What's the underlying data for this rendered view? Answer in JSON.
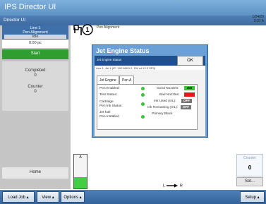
{
  "app": {
    "title": "IPS Director UI",
    "subtitle": "Director UI",
    "clock_line1": "1/24/20",
    "clock_line2": "9:37 A"
  },
  "sidebar": {
    "line": "Line 1",
    "line_sub": "Pen Alignment",
    "line_status": "Idle",
    "speed": "0.00 pc",
    "start_label": "Start",
    "completed_label": "Completed",
    "completed_value": "0",
    "counter_label": "Counter",
    "counter_value": "0",
    "home_label": "Home"
  },
  "header": {
    "pen_number": "1",
    "pen_label": "Pen Alignment"
  },
  "ink_gauge": {
    "label": "A",
    "level": 0.33
  },
  "counter_box": {
    "label": "Counter",
    "value": "0",
    "set_label": "Set..."
  },
  "direction": {
    "left": "L",
    "right": "R"
  },
  "toolbar": {
    "load_job": "Load Job",
    "view": "View",
    "options": "Options",
    "setup": "Setup"
  },
  "dialog": {
    "title": "Jet Engine Status",
    "header_text": "Jet Engine Status",
    "ok_label": "OK",
    "subtext": "Line 1, Jet 1 (IP: 192.168.0.2, FW v4.12.3 SP3)",
    "tabs": [
      "Jet Engine",
      "Pen A"
    ],
    "left_labels": [
      "Pen Enabled:",
      "Test Status:",
      "Cartridge",
      "Pen Ink Status:",
      "Jet fuel",
      "Pen Installed"
    ],
    "right_labels": [
      "Good Nozzles:",
      "Bad Nozzles:",
      "Ink Used (mL):",
      "Ink Remaining (mL):",
      "Primary Black"
    ],
    "badges": [
      "300",
      "",
      "OFF",
      "OFF"
    ],
    "colors": {
      "good": "#39c339",
      "bad": "#e11b1b",
      "off": "#777777"
    }
  }
}
